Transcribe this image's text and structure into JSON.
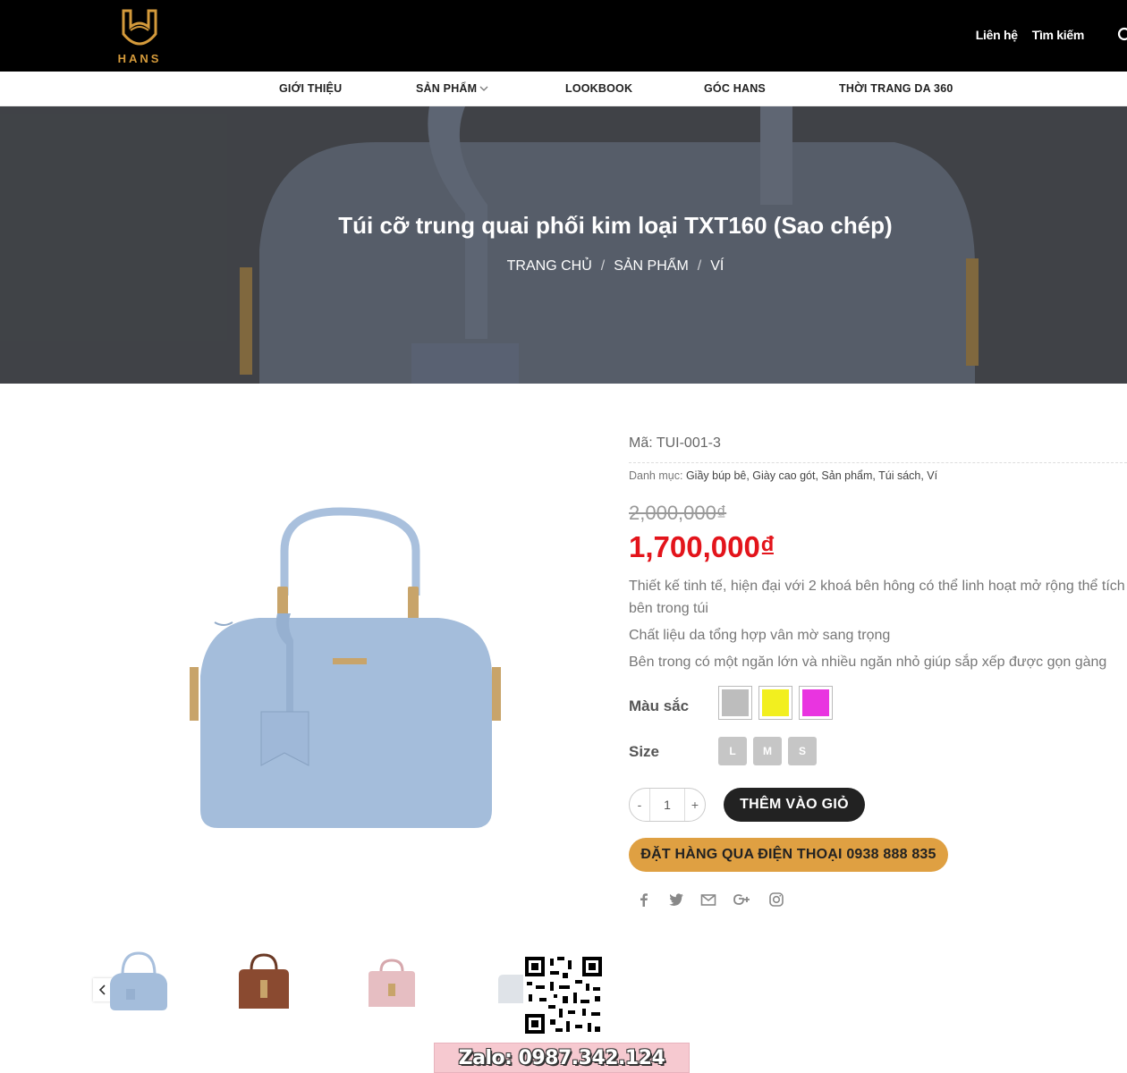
{
  "header": {
    "logo_text": "HANS",
    "links": [
      "Liên hệ",
      "Tìm kiếm"
    ]
  },
  "nav": {
    "items": [
      "GIỚI THIỆU",
      "SẢN PHẨM",
      "LOOKBOOK",
      "GÓC HANS",
      "THỜI TRANG DA 360"
    ]
  },
  "banner": {
    "title": "Túi cỡ trung quai phối kim loại TXT160 (Sao chép)",
    "breadcrumb": [
      "TRANG CHỦ",
      "SẢN PHẨM",
      "VÍ"
    ],
    "separator": "/"
  },
  "product": {
    "sku": "Mã: TUI-001-3",
    "categories_label": "Danh mục:",
    "categories": "Giầy búp bê, Giày cao gót, Sản phẩm, Túi sách, Ví",
    "old_price": "2,000,000₫",
    "new_price": "1,700,000₫",
    "description": [
      "Thiết kế tinh tế, hiện đại với 2 khoá bên hông có thể linh hoạt mở rộng thể tích bên trong túi",
      "Chất liệu da tổng hợp vân mờ sang trọng",
      "Bên trong có một ngăn lớn và nhiều ngăn nhỏ giúp sắp xếp được gọn gàng"
    ],
    "color_label": "Màu sắc",
    "colors": [
      "#bdbdbd",
      "#f2ef1f",
      "#e934e0"
    ],
    "size_label": "Size",
    "sizes": [
      "L",
      "M",
      "S"
    ],
    "quantity": "1",
    "qty_minus": "-",
    "qty_plus": "+",
    "add_to_cart": "THÊM VÀO GIỎ",
    "order_phone": "ĐẶT HÀNG QUA ĐIỆN THOẠI 0938 888 835"
  },
  "share_icons": [
    "facebook-icon",
    "twitter-icon",
    "email-icon",
    "google-plus-icon",
    "instagram-icon"
  ],
  "zalo": "Zalo: 0987.342.124",
  "colors": {
    "accent": "#dfa042",
    "sale_price": "#e3141b",
    "header_bg": "#000000"
  }
}
